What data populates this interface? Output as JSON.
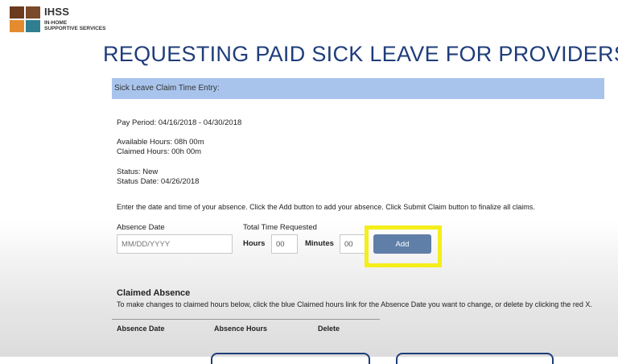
{
  "logo": {
    "name": "IHSS",
    "sub_line1": "IN-HOME",
    "sub_line2": "SUPPORTIVE SERVICES"
  },
  "page_title": "REQUESTING PAID SICK LEAVE FOR PROVIDERS",
  "form": {
    "header": "Sick Leave Claim Time Entry:",
    "pay_period": "Pay Period: 04/16/2018 - 04/30/2018",
    "available_hours": "Available Hours: 08h 00m",
    "claimed_hours": "Claimed Hours: 00h 00m",
    "status": "Status: New",
    "status_date": "Status Date: 04/26/2018",
    "instructions": "Enter the date and time of your absence. Click the Add button to add your absence. Click Submit Claim button to finalize all claims.",
    "absence_date_label": "Absence Date",
    "absence_date_placeholder": "MM/DD/YYYY",
    "total_time_label": "Total Time Requested",
    "hours_label": "Hours",
    "hours_value": "00",
    "minutes_label": "Minutes",
    "minutes_value": "00",
    "add_label": "Add"
  },
  "claimed": {
    "title": "Claimed Absence",
    "instructions": "To make changes to claimed hours below, click the blue Claimed hours link for the Absence Date you want to change, or delete by clicking the red X.",
    "columns": [
      "Absence Date",
      "Absence Hours",
      "Delete"
    ]
  },
  "colors": {
    "title_blue": "#1f3d7a",
    "header_bar": "#a9c4ec",
    "add_button": "#5f7fa8",
    "highlight": "#f4ee1b"
  }
}
